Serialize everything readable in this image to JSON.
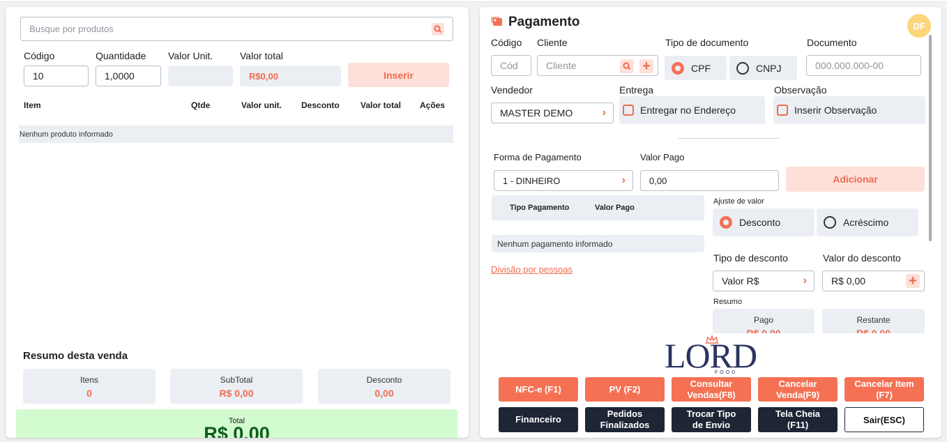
{
  "left": {
    "search_placeholder": "Busque por produtos",
    "labels": {
      "codigo": "Código",
      "quantidade": "Quantidade",
      "valor_unit": "Valor Unit.",
      "valor_total": "Valor total"
    },
    "values": {
      "codigo": "10",
      "quantidade": "1,0000",
      "valor_total": "R$0,00"
    },
    "insert_button": "Inserir",
    "table_headers": [
      "Item",
      "Qtde",
      "Valor unit.",
      "Desconto",
      "Valor total",
      "Ações"
    ],
    "empty_text": "Nenhum produto informado",
    "summary": {
      "title": "Resumo desta venda",
      "cards": [
        {
          "label": "Itens",
          "value": "0"
        },
        {
          "label": "SubTotal",
          "value": "R$ 0,00"
        },
        {
          "label": "Desconto",
          "value": "0,00"
        }
      ],
      "total_label": "Total",
      "total_value": "R$ 0.00"
    }
  },
  "right": {
    "title": "Pagamento",
    "avatar": "DF",
    "labels": {
      "codigo": "Código",
      "cliente": "Cliente",
      "tipo_documento": "Tipo de documento",
      "documento": "Documento",
      "vendedor": "Vendedor",
      "entrega": "Entrega",
      "observacao": "Observação",
      "forma_pagamento": "Forma de Pagamento",
      "valor_pago": "Valor Pago",
      "ajuste": "Ajuste de valor",
      "tipo_desconto": "Tipo de desconto",
      "valor_desconto": "Valor do desconto",
      "resumo": "Resumo"
    },
    "placeholders": {
      "codigo": "Cód",
      "cliente": "Cliente",
      "documento": "000.000.000-00"
    },
    "doc_options": [
      "CPF",
      "CNPJ"
    ],
    "doc_selected": "CPF",
    "vendedor_value": "MASTER DEMO",
    "entrega_check": "Entregar no Endereço",
    "observacao_check": "Inserir Observação",
    "forma_value": "1 - DINHEIRO",
    "valor_pago_value": "0,00",
    "add_button": "Adicionar",
    "pay_table_headers": [
      "Tipo Pagamento",
      "Valor Pago"
    ],
    "pay_empty": "Nenhum pagamento informado",
    "division_link": "Divisão por pessoas",
    "ajuste_options": [
      "Desconto",
      "Acréscimo"
    ],
    "ajuste_selected": "Desconto",
    "tipo_desconto_value": "Valor R$",
    "valor_desconto_value": "R$ 0,00",
    "resumo_cards": [
      {
        "label": "Pago",
        "value": "R$ 0,00"
      },
      {
        "label": "Restante",
        "value": "R$ 0,00"
      }
    ],
    "logo_text": "LORD",
    "logo_sub": "FOOD",
    "buttons_row1": [
      "NFC-e (F1)",
      "PV (F2)",
      "Consultar Vendas(F8)",
      "Cancelar Venda(F9)",
      "Cancelar Item (F7)"
    ],
    "buttons_row2": [
      "Financeiro",
      "Pedidos Finalizados",
      "Trocar Tipo de Envio",
      "Tela Cheia (F11)",
      "Sair(ESC)"
    ]
  },
  "colors": {
    "accent": "#f57154",
    "dark": "#1e2534",
    "total_bg": "#d3fbd0",
    "total_text": "#0f5c1a"
  }
}
